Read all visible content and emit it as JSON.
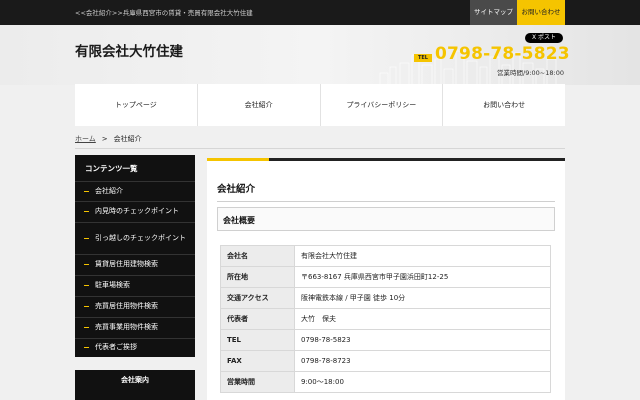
{
  "topbar": {
    "breadcrumb": "<<会社紹介>>兵庫県西宮市の賃貸・売買有限会社大竹住建",
    "sitemap": "サイトマップ",
    "contact": "お問い合わせ"
  },
  "header": {
    "company": "有限会社大竹住建",
    "x_post": "X ポスト",
    "tel_badge": "TEL",
    "tel": "0798-78-5823",
    "hours": "営業時間/9:00~18:00"
  },
  "nav": [
    "トップページ",
    "会社紹介",
    "プライバシーポリシー",
    "お問い合わせ"
  ],
  "breadcrumb": {
    "home": "ホーム",
    "sep": ">",
    "current": "会社紹介"
  },
  "sidebar": {
    "title": "コンテンツ一覧",
    "items": [
      "会社紹介",
      "内見時のチェックポイント",
      "引っ越しのチェックポイント",
      "賃貸居住用建物検索",
      "駐車場検索",
      "売買居住用物件検索",
      "売買事業用物件検索",
      "代表者ご挨拶"
    ],
    "section2": "会社案内"
  },
  "main": {
    "title": "会社紹介",
    "subtitle": "会社概要",
    "rows": [
      {
        "label": "会社名",
        "value": "有限会社大竹住建"
      },
      {
        "label": "所在地",
        "value": "〒663-8167 兵庫県西宮市甲子園浜田町12-25"
      },
      {
        "label": "交通アクセス",
        "value": "阪神電鉄本線 / 甲子園 徒歩 10分"
      },
      {
        "label": "代表者",
        "value": "大竹　保夫"
      },
      {
        "label": "TEL",
        "value": "0798-78-5823"
      },
      {
        "label": "FAX",
        "value": "0798-78-8723"
      },
      {
        "label": "営業時間",
        "value": "9:00～18:00"
      }
    ]
  },
  "colors": {
    "accent": "#f5c400",
    "dark": "#111111"
  }
}
